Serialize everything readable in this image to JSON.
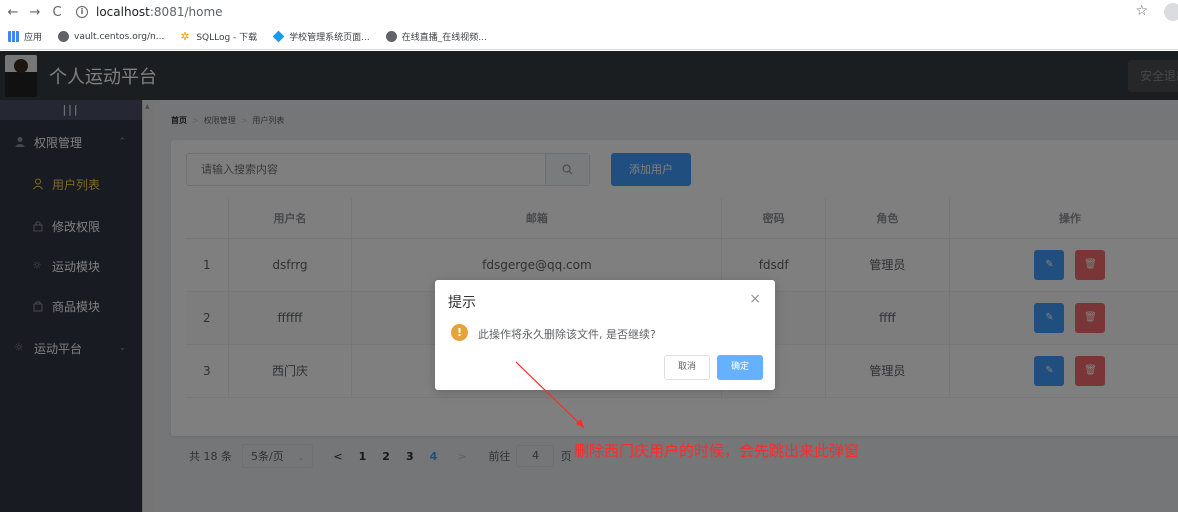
{
  "browser": {
    "url_host": "localhost",
    "url_path": ":8081/home",
    "bookmarks": [
      {
        "label": "应用",
        "icon": "apps-icon"
      },
      {
        "label": "vault.centos.org/n...",
        "icon": "globe-icon"
      },
      {
        "label": "SQLLog - 下载",
        "icon": "sqllog-icon"
      },
      {
        "label": "学校管理系统页面...",
        "icon": "diamond-icon"
      },
      {
        "label": "在线直播_在线视频...",
        "icon": "globe-icon"
      }
    ]
  },
  "header": {
    "title": "个人运动平台",
    "logout_label": "安全退出"
  },
  "sidebar": {
    "toggle": "|||",
    "items": [
      {
        "label": "权限管理",
        "icon": "user-icon",
        "arrow": "^"
      },
      {
        "label": "用户列表",
        "icon": "user-outline-icon",
        "active": true
      },
      {
        "label": "修改权限",
        "icon": "lock-icon"
      },
      {
        "label": "运动模块",
        "icon": "sun-icon"
      },
      {
        "label": "商品模块",
        "icon": "goods-icon"
      },
      {
        "label": "运动平台",
        "icon": "sun-icon",
        "arrow": "v"
      }
    ]
  },
  "breadcrumb": {
    "home": "首页",
    "level1": "权限管理",
    "level2": "用户列表"
  },
  "search": {
    "placeholder": "请输入搜索内容",
    "add_label": "添加用户"
  },
  "table": {
    "headers": [
      "",
      "用户名",
      "邮箱",
      "密码",
      "角色",
      "操作"
    ],
    "rows": [
      {
        "index": "1",
        "username": "dsfrrg",
        "email": "fdsgerge@qq.com",
        "password": "fdsdf",
        "role": "管理员"
      },
      {
        "index": "2",
        "username": "ffffff",
        "email": "",
        "password": "",
        "role": "ffff"
      },
      {
        "index": "3",
        "username": "西门庆",
        "email": "",
        "password": "",
        "role": "管理员"
      }
    ]
  },
  "pager": {
    "total": "共 18 条",
    "size": "5条/页",
    "prev": "<",
    "pages": [
      "1",
      "2",
      "3",
      "4"
    ],
    "current": "4",
    "next": ">",
    "goto_label": "前往",
    "goto_value": "4",
    "page_unit": "页"
  },
  "dialog": {
    "title": "提示",
    "close": "×",
    "warn": "!",
    "message": "此操作将永久删除该文件, 是否继续?",
    "cancel": "取消",
    "ok": "确定"
  },
  "annotation": {
    "text": "删除西门庆用户的时候，会先跳出来此弹窗",
    "color": "#ff2a2a"
  },
  "colors": {
    "accent": "#409eff",
    "danger": "#f56c6c",
    "sidebar_active": "#ffd04b",
    "header_bg": "#373d41",
    "sidebar_bg": "#333744"
  }
}
